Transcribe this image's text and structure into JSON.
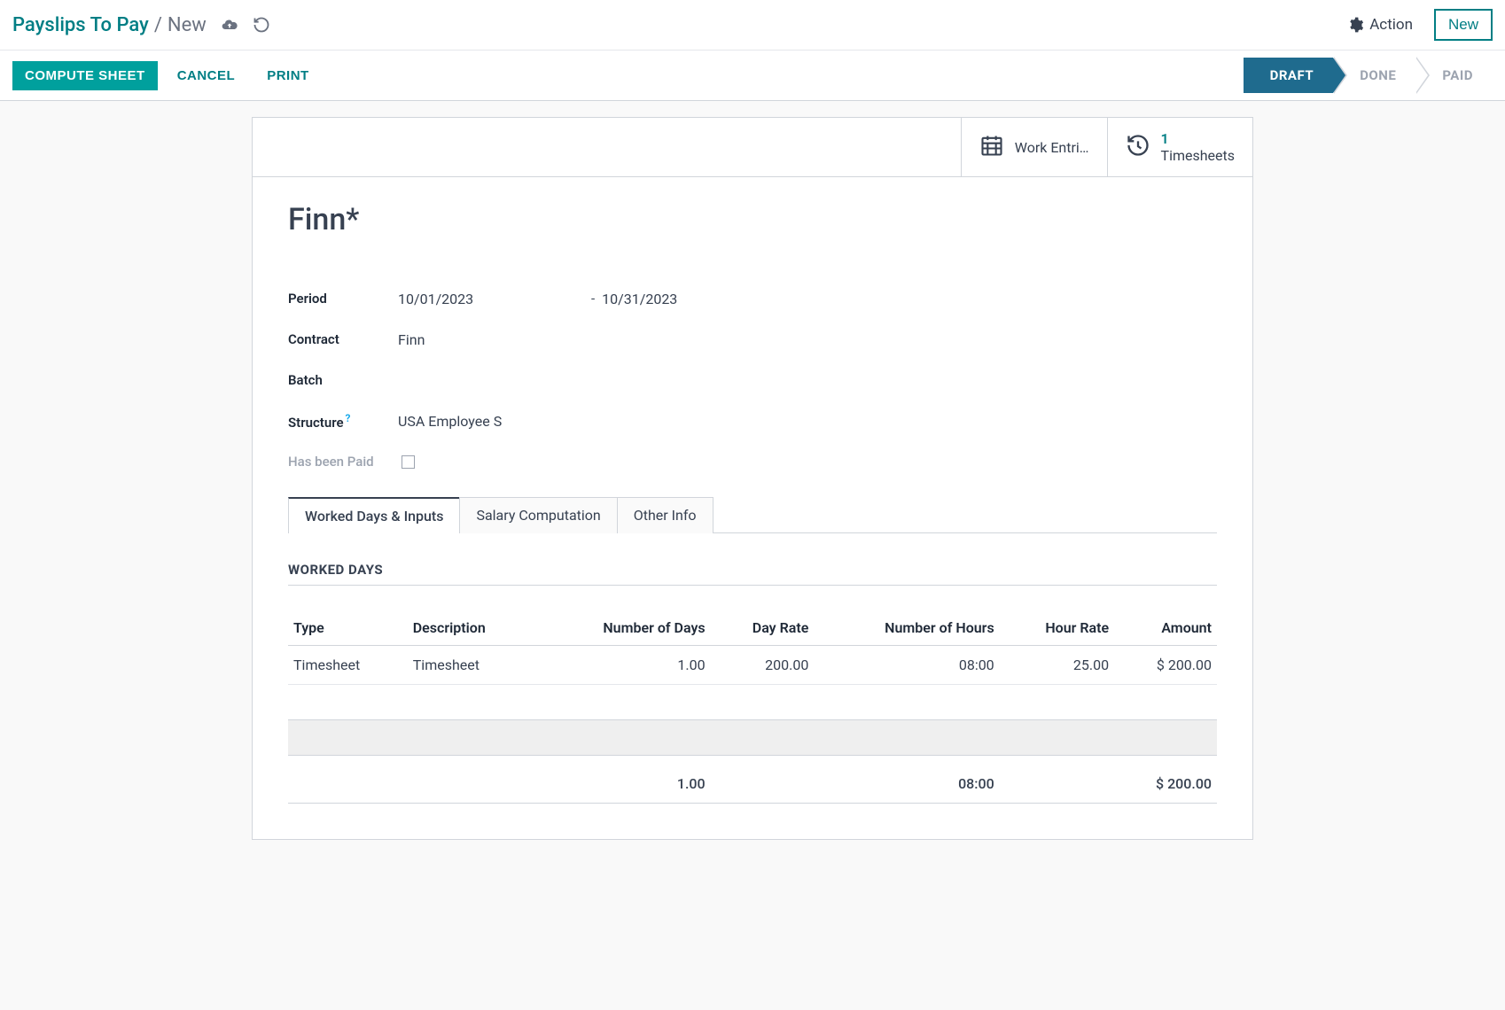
{
  "breadcrumb": {
    "root": "Payslips To Pay",
    "current": "New"
  },
  "topbar": {
    "action_label": "Action",
    "new_label": "New"
  },
  "actions": {
    "compute": "COMPUTE SHEET",
    "cancel": "CANCEL",
    "print": "PRINT"
  },
  "status": {
    "draft": "DRAFT",
    "done": "DONE",
    "paid": "PAID",
    "active": "draft"
  },
  "stats": {
    "work_entries": {
      "label": "Work Entri…"
    },
    "timesheets": {
      "count": "1",
      "label": "Timesheets"
    }
  },
  "record": {
    "title": "Finn*",
    "labels": {
      "period": "Period",
      "contract": "Contract",
      "batch": "Batch",
      "structure": "Structure",
      "has_paid": "Has been Paid"
    },
    "period_from": "10/01/2023",
    "period_sep": "-",
    "period_to": "10/31/2023",
    "contract": "Finn",
    "batch": "",
    "structure": "USA Employee S",
    "has_paid": false
  },
  "tabs": {
    "worked": "Worked Days & Inputs",
    "salary": "Salary Computation",
    "other": "Other Info",
    "active": "worked"
  },
  "worked_days": {
    "section_title": "WORKED DAYS",
    "columns": {
      "type": "Type",
      "description": "Description",
      "days": "Number of Days",
      "day_rate": "Day Rate",
      "hours": "Number of Hours",
      "hour_rate": "Hour Rate",
      "amount": "Amount"
    },
    "rows": [
      {
        "type": "Timesheet",
        "description": "Timesheet",
        "days": "1.00",
        "day_rate": "200.00",
        "hours": "08:00",
        "hour_rate": "25.00",
        "amount": "$ 200.00"
      }
    ],
    "totals": {
      "days": "1.00",
      "hours": "08:00",
      "amount": "$ 200.00"
    }
  }
}
